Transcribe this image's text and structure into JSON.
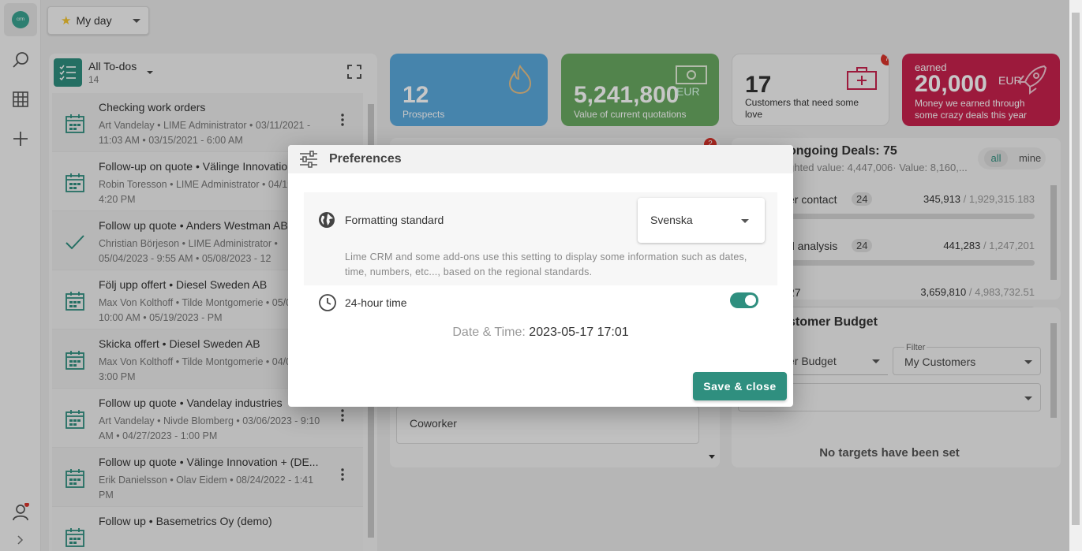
{
  "topbar": {
    "myday_label": "My day"
  },
  "rail": {
    "logo_text": "crm"
  },
  "todos": {
    "title": "All To-dos",
    "count": "14",
    "items": [
      {
        "title": "Checking work orders",
        "sub": "Art Vandelay • LIME Administrator • 03/11/2021 - 11:03 AM • 03/15/2021 - 6:00 AM",
        "icon": "calendar-icon",
        "menu": true
      },
      {
        "title": "Follow-up on quote • Välinge Innovation",
        "sub": "Robin Toresson • LIME Administrator • 04/19/2021 - 4:20 PM",
        "icon": "calendar-icon",
        "menu": false
      },
      {
        "title": "Follow up quote • Anders Westman AB",
        "sub": "Christian Börjeson • LIME Administrator • 05/04/2023 - 9:55 AM • 05/08/2023 - 12",
        "icon": "check-icon",
        "menu": false
      },
      {
        "title": "Följ upp offert • Diesel Sweden AB",
        "sub": "Max Von Kolthoff • Tilde Montgomerie • 05/08/2023 - 10:00 AM • 05/19/2023 - PM",
        "icon": "calendar-icon",
        "menu": false
      },
      {
        "title": "Skicka offert • Diesel Sweden AB",
        "sub": "Max Von Kolthoff • Tilde Montgomerie • 04/04/2023 - 3:00 PM",
        "icon": "calendar-icon",
        "menu": false
      },
      {
        "title": "Follow up quote • Vandelay industries",
        "sub": "Art Vandelay • Nivde Blomberg • 03/06/2023 - 9:10 AM • 04/27/2023 - 1:00 PM",
        "icon": "calendar-icon",
        "menu": true
      },
      {
        "title": "Follow up quote • Välinge Innovation + (DE...",
        "sub": "Erik Danielsson • Olav Eidem • 08/24/2022 - 1:41 PM",
        "icon": "calendar-icon",
        "menu": true
      },
      {
        "title": "Follow up • Basemetrics Oy (demo)",
        "sub": "",
        "icon": "calendar-icon",
        "menu": false
      }
    ]
  },
  "cards": {
    "prospects": {
      "value": "12",
      "label": "Prospects"
    },
    "quotations": {
      "value": "5,241,800",
      "unit": "EUR",
      "label": "Value of current quotations"
    },
    "customers": {
      "value": "17",
      "label": "Customers that need some love",
      "badge": "7"
    },
    "earned": {
      "top": "earned",
      "value": "20,000",
      "unit": "EUR",
      "label": "Money we earned through some crazy deals this year"
    }
  },
  "deals": {
    "title": "ongoing Deals: 75",
    "sub": "ghted value: 4,447,006· Value: 8,160,...",
    "filter_all": "all",
    "filter_mine": "mine",
    "rows": [
      {
        "name": "er contact",
        "count": "24",
        "value": "345,913",
        "total": "/ 1,929,315.183",
        "progress": 0.06
      },
      {
        "name": "d analysis",
        "count": "24",
        "value": "441,283",
        "total": "/ 1,247,201",
        "progress": 0
      },
      {
        "name": "27",
        "count": "",
        "value": "3,659,810",
        "total": "/ 4,983,732.51",
        "progress": 0
      }
    ]
  },
  "budget": {
    "title": "stomer Budget",
    "select1": "er Budget",
    "filter_label": "Filter",
    "filter_value": "My Customers",
    "empty": "No targets have been set"
  },
  "midpanel": {
    "coworker": "Coworker",
    "badge": "2"
  },
  "modal": {
    "title": "Preferences",
    "formatting_label": "Formatting standard",
    "formatting_value": "Svenska",
    "formatting_help": "Lime CRM and some add-ons use this setting to display some information such as dates, time, numbers, etc..., based on the regional standards.",
    "hour24_label": "24-hour time",
    "hour24_enabled": true,
    "datetime_label": "Date & Time:",
    "datetime_value": "2023-05-17 17:01",
    "save_label": "Save & close"
  },
  "colors": {
    "accent": "#2f8f7f",
    "prospects": "#5aa9dd",
    "quotations": "#6aaa62",
    "earned": "#c8224e"
  }
}
